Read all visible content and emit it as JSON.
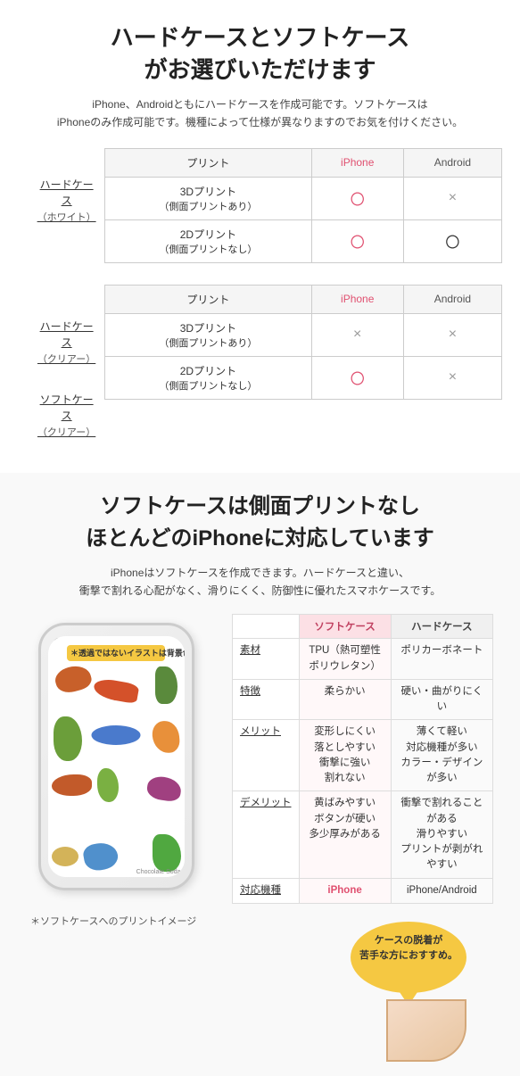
{
  "section1": {
    "main_title": "ハードケースとソフトケース\nがお選びいただけます",
    "subtitle": "iPhone、Androidともにハードケースを作成可能です。ソフトケースは\niPhoneのみ作成可能です。機種によって仕様が異なりますのでお気を付けください。",
    "table1": {
      "headers": [
        "プリント",
        "iPhone",
        "Android"
      ],
      "row_label": "ハードケース\n（ホワイト）",
      "rows": [
        {
          "print": "3Dプリント\n（側面プリントあり）",
          "iphone": "〇",
          "android": "×"
        },
        {
          "print": "2Dプリント\n（側面プリントなし）",
          "iphone": "〇",
          "android": "〇"
        }
      ]
    },
    "table2": {
      "headers": [
        "プリント",
        "iPhone",
        "Android"
      ],
      "row_labels": [
        "ハードケース\n（クリアー）",
        "ソフトケース\n（クリアー）"
      ],
      "rows": [
        {
          "print": "3Dプリント\n（側面プリントあり）",
          "iphone": "×",
          "android": "×"
        },
        {
          "print": "2Dプリント\n（側面プリントなし）",
          "iphone": "〇",
          "android": "×"
        }
      ]
    }
  },
  "section2": {
    "title": "ソフトケースは側面プリントなし\nほとんどのiPhoneに対応しています",
    "subtitle": "iPhoneはソフトケースを作成できます。ハードケースと違い、\n衝撃で割れる心配がなく、滑りにくく、防御性に優れたスマホケースです。",
    "annotation_bubble": "＊透過ではないイラストは\n背景色もプリント",
    "comparison_table": {
      "headers": [
        "",
        "ソフトケース",
        "ハードケース"
      ],
      "rows": [
        {
          "label": "素材",
          "soft": "TPU（熱可塑性ポリウレタン）",
          "hard": "ポリカーボネート"
        },
        {
          "label": "特徴",
          "soft": "柔らかい",
          "hard": "硬い・曲がりにくい"
        },
        {
          "label": "メリット",
          "soft": "変形しにくい\n落としやすい\n衝撃に強い\n割れない",
          "hard": "薄くて軽い\n対応機種が多い\nカラー・デザインが多い"
        },
        {
          "label": "デメリット",
          "soft": "黄ばみやすい\nボタンが硬い\n多少厚みがある",
          "hard": "衝撃で割れることがある\n滑りやすい\nプリントが剥がれやすい"
        },
        {
          "label": "対応機種",
          "soft": "iPhone",
          "hard": "iPhone/Android"
        }
      ]
    },
    "balloon_text": "ケースの脱着が\n苦手な方におすすめ。",
    "bottom_note": "＊ソフトケースへのプリントイメージ"
  }
}
